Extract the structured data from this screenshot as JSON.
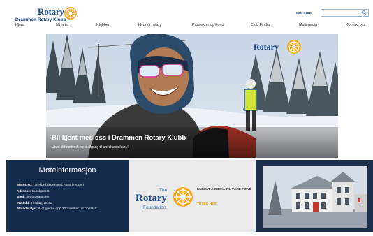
{
  "header": {
    "logo_word": "Rotary",
    "logo_club": "Drammen Rotary Klubb",
    "minside": "MIN SIDE",
    "search_placeholder": ""
  },
  "nav": [
    "Hjem",
    "Nyheter",
    "Klubben",
    "Hvorfor rotary",
    "Prosjekter og Fond",
    "Club Finder",
    "Multimedia",
    "Kontakt oss"
  ],
  "hero": {
    "logo_word": "Rotary",
    "title": "Bli kjent med oss i Drammen Rotary Klubb",
    "subtitle": "Utvid ditt nettverk og få tilgang til unik kunnskap..!!"
  },
  "meeting": {
    "title": "Møteinformasjon",
    "lines": [
      {
        "label": "Møtested:",
        "value": " Direktørboligen ved Aass bryggeri"
      },
      {
        "label": "Adresse:",
        "value": " Sundgata 6"
      },
      {
        "label": "Sted:",
        "value": " 3015 Drammen"
      },
      {
        "label": "Møtetid:",
        "value": " Tirsdag, 18:30"
      },
      {
        "label": "Møtedetaljer:",
        "value": " Møt gjerne opp 30 minutter før oppstart."
      }
    ]
  },
  "foundation": {
    "the": "The",
    "rotary": "Rotary",
    "foundation": "Foundation",
    "text": "ENKELT Å BIDRA TIL VÅRE FOND",
    "link": "TRYKK HER"
  },
  "colors": {
    "brand_blue": "#17458f",
    "gold": "#f7a81b",
    "navy": "#142b4c"
  }
}
